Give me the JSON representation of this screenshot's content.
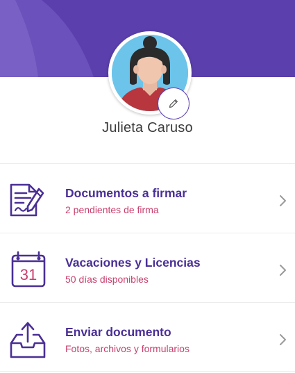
{
  "colors": {
    "brand": "#5b3fad",
    "title": "#4a2f96",
    "subtitle": "#c8406e",
    "name": "#3b3b3b"
  },
  "profile": {
    "name": "Julieta Caruso",
    "avatar_icon": "user-avatar-illustration",
    "edit_icon": "pencil-icon"
  },
  "menu": {
    "items": [
      {
        "title": "Documentos a firmar",
        "subtitle": "2 pendientes de firma",
        "icon": "sign-document-icon"
      },
      {
        "title": "Vacaciones y Licencias",
        "subtitle": "50 días disponibles",
        "icon": "calendar-icon",
        "calendar_day": "31"
      },
      {
        "title": "Enviar documento",
        "subtitle": "Fotos, archivos y formularios",
        "icon": "upload-tray-icon"
      }
    ]
  }
}
